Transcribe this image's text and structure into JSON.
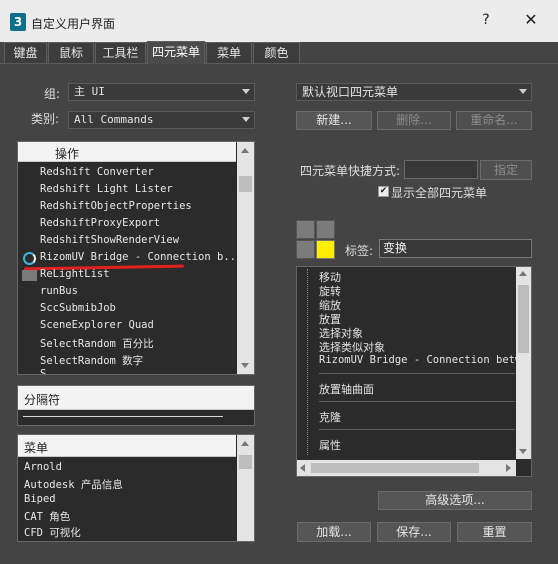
{
  "window": {
    "title": "自定义用户界面",
    "app_icon": "3",
    "help": "?",
    "close": "✕"
  },
  "tabs": [
    "键盘",
    "鼠标",
    "工具栏",
    "四元菜单",
    "菜单",
    "颜色"
  ],
  "left": {
    "group_label": "组:",
    "group_value": "主 UI",
    "category_label": "类别:",
    "category_value": "All Commands",
    "actions_header": "操作",
    "actions": [
      "Redshift Converter",
      "Redshift Light Lister",
      "RedshiftObjectProperties",
      "RedshiftProxyExport",
      "RedshiftShowRenderView",
      "RizomUV Bridge - Connection b...",
      "ReLightList",
      "runBus",
      "SccSubmibJob",
      "SceneExplorer Quad",
      "SelectRandom 百分比",
      "SelectRandom 数字",
      "S..."
    ],
    "separator_header": "分隔符",
    "menus_header": "菜单",
    "menus": [
      "Arnold",
      "Autodesk 产品信息",
      "Biped",
      "CAT 角色",
      "CFD 可视化"
    ]
  },
  "right": {
    "quad_dropdown": "默认视口四元菜单",
    "new_btn": "新建...",
    "delete_btn": "删除...",
    "rename_btn": "重命名...",
    "shortcut_label": "四元菜单快捷方式:",
    "shortcut_value": "",
    "assign_btn": "指定",
    "show_all_label": "显示全部四元菜单",
    "label_label": "标签:",
    "label_value": "变换",
    "quad_items": [
      "移动",
      "旋转",
      "缩放",
      "放置",
      "选择对象",
      "选择类似对象",
      "RizomUV Bridge - Connection betw"
    ],
    "quad_sections": [
      "放置轴曲面",
      "克隆",
      "属性"
    ],
    "advanced_btn": "高级选项...",
    "load_btn": "加载...",
    "save_btn": "保存...",
    "reset_btn": "重置"
  },
  "colors": {
    "accent_yellow": "#ffee00",
    "annotation_red": "#e0211d",
    "bg": "#444444"
  }
}
